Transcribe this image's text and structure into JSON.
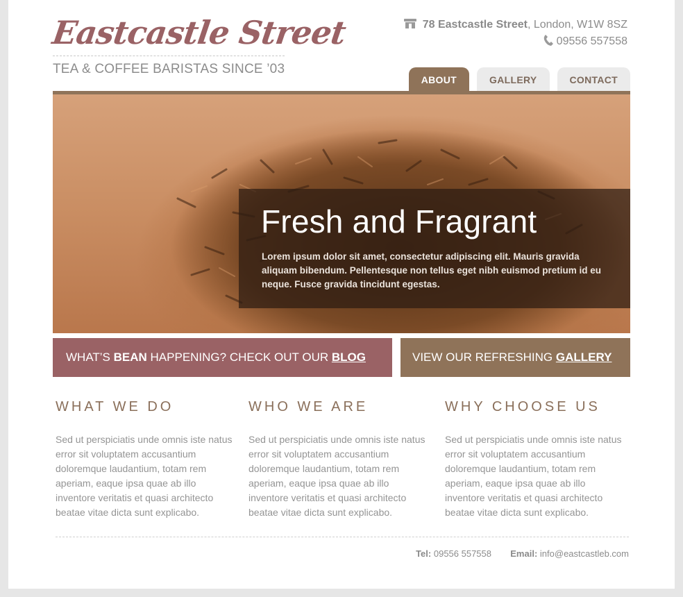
{
  "brand": {
    "title": "Eastcastle Street",
    "tagline": "TEA & COFFEE BARISTAS SINCE ’03"
  },
  "address": {
    "street": "78 Eastcastle Street",
    "city": ", London, W1W 8SZ",
    "phone": "09556 557558",
    "icons": [
      "shop-icon",
      "phone-icon"
    ]
  },
  "nav": {
    "tabs": [
      {
        "label": "ABOUT",
        "active": true
      },
      {
        "label": "GALLERY",
        "active": false
      },
      {
        "label": "CONTACT",
        "active": false
      }
    ]
  },
  "hero": {
    "title": "Fresh and Fragrant",
    "text": "Lorem ipsum dolor sit amet, consectetur adipiscing elit. Mauris gravida aliquam bibendum. Pellentesque non tellus eget nibh euismod pretium id eu neque. Fusce gravida tincidunt egestas."
  },
  "cta": {
    "blog": {
      "pre": "WHAT’S ",
      "bold": "BEAN",
      "mid": " HAPPENING? CHECK OUT OUR ",
      "link": "BLOG"
    },
    "gallery": {
      "pre": "VIEW OUR REFRESHING ",
      "link": "GALLERY"
    }
  },
  "columns": [
    {
      "heading": "WHAT WE DO",
      "text": "Sed ut perspiciatis unde omnis iste natus error sit voluptatem accusantium doloremque laudantium, totam rem aperiam, eaque ipsa quae ab illo inventore veritatis et quasi architecto beatae vitae dicta sunt explicabo."
    },
    {
      "heading": "WHO WE ARE",
      "text": "Sed ut perspiciatis unde omnis iste natus error sit voluptatem accusantium doloremque laudantium, totam rem aperiam, eaque ipsa quae ab illo inventore veritatis et quasi architecto beatae vitae dicta sunt explicabo."
    },
    {
      "heading": "WHY CHOOSE US",
      "text": "Sed ut perspiciatis unde omnis iste natus error sit voluptatem accusantium doloremque laudantium, totam rem aperiam, eaque ipsa quae ab illo inventore veritatis et quasi architecto beatae vitae dicta sunt explicabo."
    }
  ],
  "footer": {
    "tel_label": "Tel:",
    "tel": "09556 557558",
    "email_label": "Email:",
    "email": "info@eastcastleb.com"
  },
  "colors": {
    "brand_rose": "#9a6265",
    "brand_brown": "#8f7359",
    "text_grey": "#949494"
  }
}
